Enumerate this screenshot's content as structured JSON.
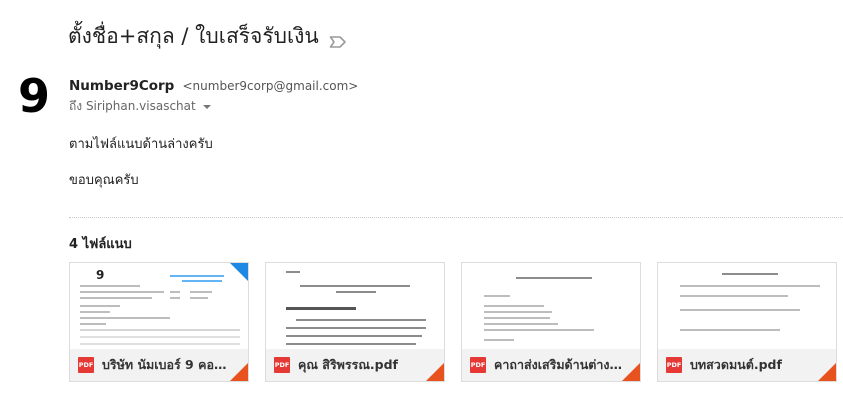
{
  "email": {
    "subject": "ตั้งชื่อ+สกุล / ใบเสร็จรับเงิน",
    "label_icon": "label-outline-icon",
    "sender": {
      "avatar_glyph": "9",
      "name": "Number9Corp",
      "email": "<number9corp@gmail.com>",
      "to_text": "ถึง Siriphan.visaschat"
    },
    "body": [
      "ตามไฟล์แนบด้านล่างครับ",
      "ขอบคุณครับ"
    ],
    "attachments_count_label": "4 ไฟล์แนบ",
    "attachments": [
      {
        "name": "บริษัท นัมเบอร์ 9 คอร์...",
        "type_badge": "PDF"
      },
      {
        "name": "คุณ สิริพรรณ.pdf",
        "type_badge": "PDF"
      },
      {
        "name": "คาถาส่งเสริมด้านต่าง...",
        "type_badge": "PDF"
      },
      {
        "name": "บทสวดมนต์.pdf",
        "type_badge": "PDF"
      }
    ]
  },
  "colors": {
    "pdf_red": "#e53935",
    "fold_orange": "#e8521e",
    "receipt_blue": "#1e88e5"
  }
}
